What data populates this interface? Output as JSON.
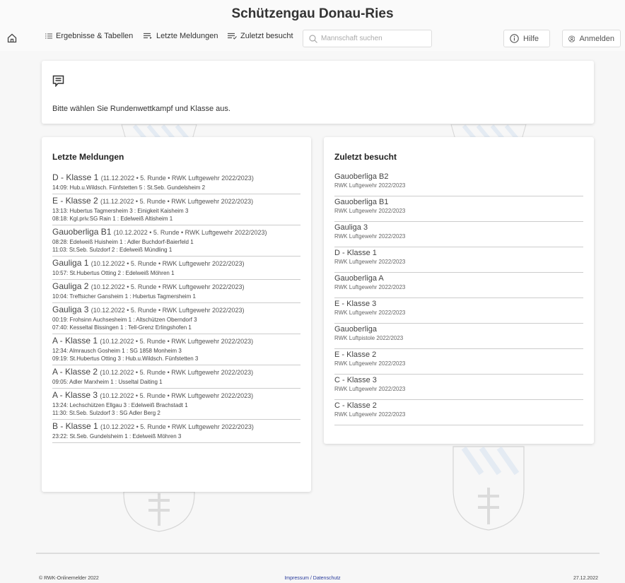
{
  "header": {
    "title": "Schützengau Donau-Ries",
    "nav": {
      "home_icon": "home-icon",
      "results": "Ergebnisse & Tabellen",
      "latest": "Letzte Meldungen",
      "recent": "Zuletzt besucht",
      "search_placeholder": "Mannschaft suchen",
      "help": "Hilfe",
      "login": "Anmelden"
    }
  },
  "info": {
    "text": "Bitte wählen Sie Rundenwettkampf und Klasse aus."
  },
  "latest": {
    "title": "Letzte Meldungen",
    "items": [
      {
        "class": "D - Klasse 1",
        "meta": "(11.12.2022 • 5. Runde • RWK Luftgewehr 2022/2023)",
        "lines": [
          "14:09: Hub.u.Wildsch. Fünfstetten 5 : St.Seb. Gundelsheim 2"
        ]
      },
      {
        "class": "E - Klasse 2",
        "meta": "(11.12.2022 • 5. Runde • RWK Luftgewehr 2022/2023)",
        "lines": [
          "13:13: Hubertus Tagmersheim 3 : Einigkeit Kaisheim 3",
          "08:18: Kgl.priv.SG Rain 1 : Edelweiß Altisheim 1"
        ]
      },
      {
        "class": "Gauoberliga B1",
        "meta": "(10.12.2022 • 5. Runde • RWK Luftgewehr 2022/2023)",
        "lines": [
          "08:28: Edelweiß Huisheim 1 : Adler Buchdorf-Baierfeld 1",
          "11:03: St.Seb. Sulzdorf 2 : Edelweiß Mündling 1"
        ]
      },
      {
        "class": "Gauliga 1",
        "meta": "(10.12.2022 • 5. Runde • RWK Luftgewehr 2022/2023)",
        "lines": [
          "10:57: St.Hubertus Otting 2 : Edelweiß Möhren 1"
        ]
      },
      {
        "class": "Gauliga 2",
        "meta": "(10.12.2022 • 5. Runde • RWK Luftgewehr 2022/2023)",
        "lines": [
          "10:04: Treffsicher Gansheim 1 : Hubertus Tagmersheim 1"
        ]
      },
      {
        "class": "Gauliga 3",
        "meta": "(10.12.2022 • 5. Runde • RWK Luftgewehr 2022/2023)",
        "lines": [
          "00:19: Frohsinn Auchsesheim 1 : Altschützen Oberndorf 3",
          "07:40: Kesseltal Bissingen 1 : Tell-Grenz Erlingshofen 1"
        ]
      },
      {
        "class": "A - Klasse 1",
        "meta": "(10.12.2022 • 5. Runde • RWK Luftgewehr 2022/2023)",
        "lines": [
          "12:34: Almrausch Gosheim 1 : SG 1858 Monheim 3",
          "09:19: St.Hubertus Otting 3 : Hub.u.Wildsch. Fünfstetten 3"
        ]
      },
      {
        "class": "A - Klasse 2",
        "meta": "(10.12.2022 • 5. Runde • RWK Luftgewehr 2022/2023)",
        "lines": [
          "09:05: Adler Marxheim 1 : Usseltal Daiting 1"
        ]
      },
      {
        "class": "A - Klasse 3",
        "meta": "(10.12.2022 • 5. Runde • RWK Luftgewehr 2022/2023)",
        "lines": [
          "13:24: Lechschützen Ellgau 3 : Edelweiß Brachstadt 1",
          "11:30: St.Seb. Sulzdorf 3 : SG Adler Berg 2"
        ]
      },
      {
        "class": "B - Klasse 1",
        "meta": "(10.12.2022 • 5. Runde • RWK Luftgewehr 2022/2023)",
        "lines": [
          "23:22: St.Seb. Gundelsheim 1 : Edelweiß Möhren 3"
        ]
      }
    ]
  },
  "recent": {
    "title": "Zuletzt besucht",
    "items": [
      {
        "title": "Gauoberliga B2",
        "sub": "RWK Luftgewehr 2022/2023"
      },
      {
        "title": "Gauoberliga B1",
        "sub": "RWK Luftgewehr 2022/2023"
      },
      {
        "title": "Gauliga 3",
        "sub": "RWK Luftgewehr 2022/2023"
      },
      {
        "title": "D - Klasse 1",
        "sub": "RWK Luftgewehr 2022/2023"
      },
      {
        "title": "Gauoberliga A",
        "sub": "RWK Luftgewehr 2022/2023"
      },
      {
        "title": "E - Klasse 3",
        "sub": "RWK Luftgewehr 2022/2023"
      },
      {
        "title": "Gauoberliga",
        "sub": "RWK Luftpistole 2022/2023"
      },
      {
        "title": "E - Klasse 2",
        "sub": "RWK Luftgewehr 2022/2023"
      },
      {
        "title": "C - Klasse 3",
        "sub": "RWK Luftgewehr 2022/2023"
      },
      {
        "title": "C - Klasse 2",
        "sub": "RWK Luftgewehr 2022/2023"
      }
    ]
  },
  "footer": {
    "copyright": "© RWK-Onlinemelder 2022",
    "links": "Impressum / Datenschutz",
    "date": "27.12.2022"
  },
  "colors": {
    "background": "#f7f7f7",
    "card": "#ffffff",
    "link": "#2a3c9c",
    "watermark": "#6f9bd0"
  }
}
